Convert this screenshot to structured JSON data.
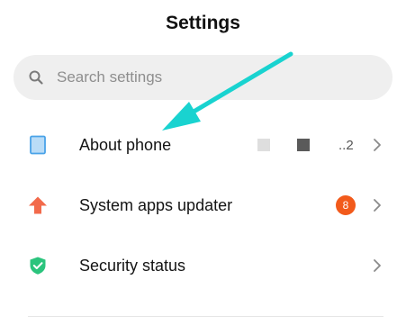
{
  "header": {
    "title": "Settings"
  },
  "search": {
    "placeholder": "Search settings",
    "icon": "search-icon"
  },
  "items": [
    {
      "label": "About phone",
      "icon": "phone-outline-icon",
      "icon_color": "#4aa3e8",
      "value": "..2"
    },
    {
      "label": "System apps updater",
      "icon": "up-arrow-icon",
      "icon_color": "#f26a4b",
      "badge": "8"
    },
    {
      "label": "Security status",
      "icon": "shield-check-icon",
      "icon_color": "#2bc47d"
    }
  ],
  "annotation": {
    "arrow_color": "#19d3d0"
  }
}
